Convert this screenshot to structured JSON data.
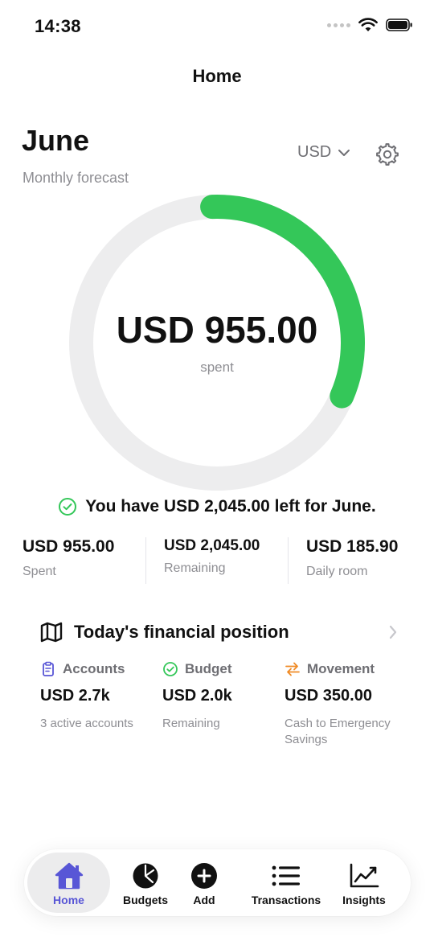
{
  "status_bar": {
    "time": "14:38"
  },
  "nav": {
    "title": "Home"
  },
  "header": {
    "month": "June",
    "subtitle": "Monthly forecast",
    "currency": "USD"
  },
  "forecast": {
    "spent_label": "USD 955.00",
    "caption": "spent",
    "progress_fraction": 0.32,
    "summary": "You have USD 2,045.00 left for June."
  },
  "stats": [
    {
      "value": "USD 955.00",
      "label": "Spent"
    },
    {
      "value": "USD 2,045.00",
      "label": "Remaining"
    },
    {
      "value": "USD 185.90",
      "label": "Daily room"
    }
  ],
  "financial_position": {
    "title": "Today's financial position",
    "columns": [
      {
        "label": "Accounts",
        "value": "USD 2.7k",
        "sub": "3 active accounts",
        "icon": "clipboard-icon",
        "color": "#5856d6"
      },
      {
        "label": "Budget",
        "value": "USD 2.0k",
        "sub": "Remaining",
        "icon": "check-circle-icon",
        "color": "#34c759"
      },
      {
        "label": "Movement",
        "value": "USD 350.00",
        "sub": "Cash to Emergency Savings",
        "icon": "transfer-arrows-icon",
        "color": "#f08a24"
      }
    ]
  },
  "tabs": [
    {
      "label": "Home",
      "icon": "house-icon",
      "active": true
    },
    {
      "label": "Budgets",
      "icon": "pie-chart-icon",
      "active": false
    },
    {
      "label": "Add",
      "icon": "plus-circle-icon",
      "active": false
    },
    {
      "label": "Transactions",
      "icon": "list-icon",
      "active": false
    },
    {
      "label": "Insights",
      "icon": "trend-chart-icon",
      "active": false
    }
  ],
  "colors": {
    "accent": "#5856d6",
    "progress": "#34c759",
    "track": "#ededee",
    "muted": "#8e8e93"
  }
}
